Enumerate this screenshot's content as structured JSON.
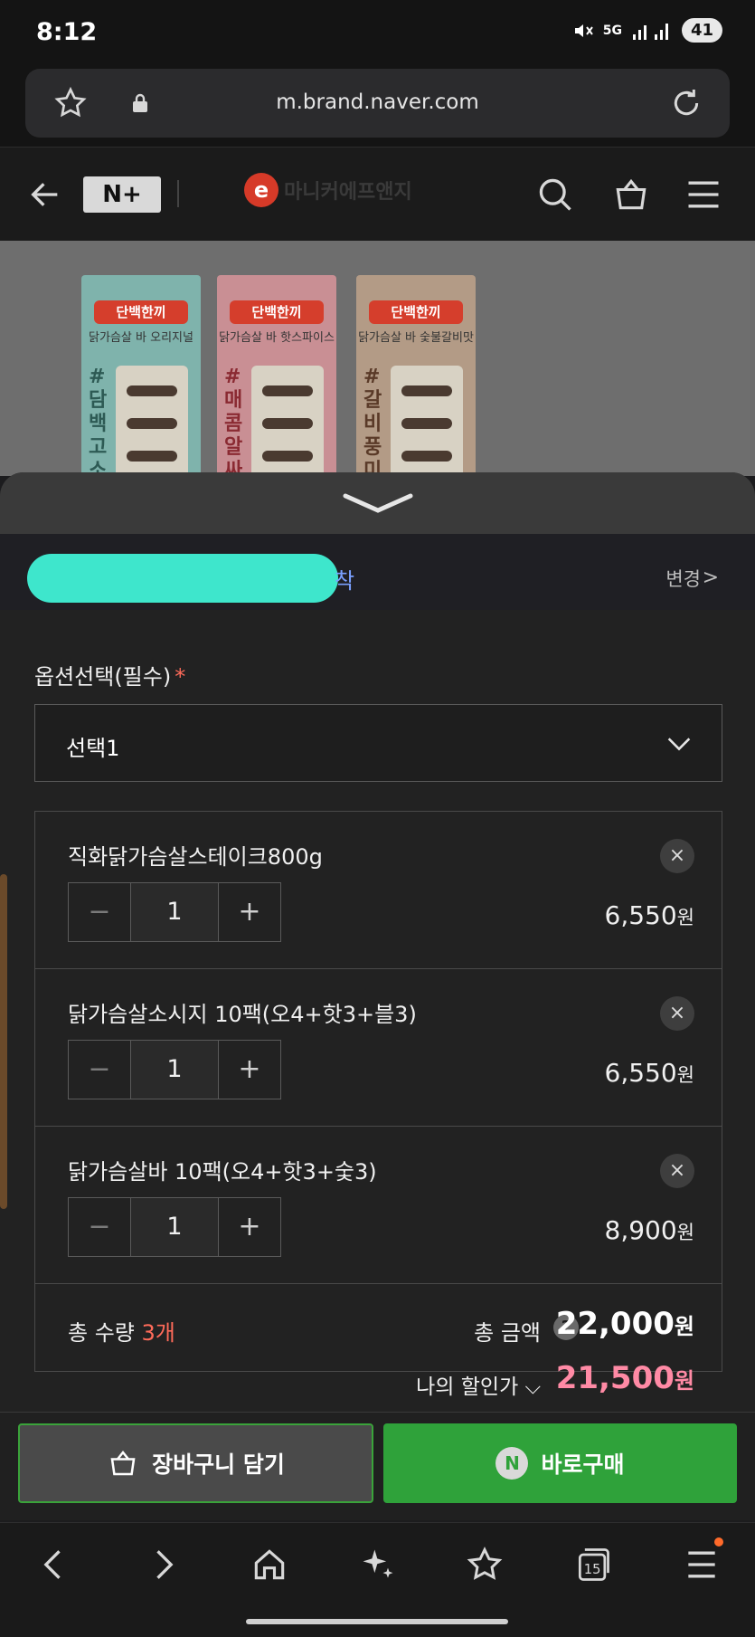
{
  "status_bar": {
    "time": "8:12",
    "network": "5G",
    "battery": "41"
  },
  "browser": {
    "url": "m.brand.naver.com"
  },
  "site_header": {
    "logo_text": "N+",
    "brand_name": "마니커에프앤지"
  },
  "product_images": [
    {
      "brand": "단백한끼",
      "flavor": "닭가슴살 바 오리지널",
      "hashtag": "#담백고소"
    },
    {
      "brand": "단백한끼",
      "flavor": "닭가슴살 바 핫스파이스",
      "hashtag": "#매콤알싸"
    },
    {
      "brand": "단백한끼",
      "flavor": "닭가슴살 바 숯불갈비맛",
      "hashtag": "#갈비풍미"
    }
  ],
  "delivery": {
    "tail_text": "착",
    "change_label": "변경",
    "change_chevron": ">"
  },
  "option": {
    "label": "옵션선택(필수)",
    "required_mark": "*",
    "selected_value": "선택1"
  },
  "items": [
    {
      "name": "직화닭가슴살스테이크800g",
      "qty": "1",
      "price": "6,550",
      "unit": "원"
    },
    {
      "name": "닭가슴살소시지 10팩(오4+핫3+블3)",
      "qty": "1",
      "price": "6,550",
      "unit": "원"
    },
    {
      "name": "닭가슴살바 10팩(오4+핫3+숯3)",
      "qty": "1",
      "price": "8,900",
      "unit": "원"
    }
  ],
  "stepper": {
    "minus": "−",
    "plus": "+",
    "remove": "×"
  },
  "totals": {
    "qty_label": "총 수량",
    "qty_value": "3개",
    "amount_label": "총 금액",
    "help_icon": "?",
    "amount_value": "22,000",
    "amount_unit": "원",
    "discount_label": "나의 할인가",
    "discount_value": "21,500",
    "discount_unit": "원"
  },
  "actions": {
    "cart_label": "장바구니 담기",
    "buy_label": "바로구매",
    "buy_badge": "N"
  },
  "navbar": {
    "tabs_count": "15"
  },
  "colors": {
    "accent_green": "#2fa23a",
    "discount_pink": "#ff8aa5",
    "required_red": "#ff6b5a"
  }
}
